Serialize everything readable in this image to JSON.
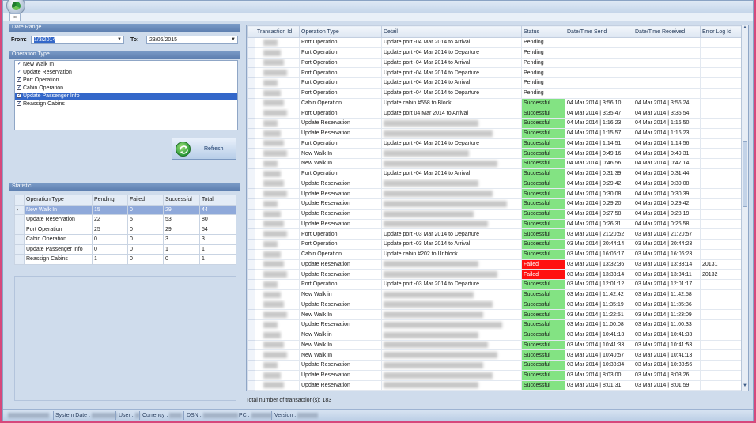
{
  "window": {
    "close_tab": "×"
  },
  "date_range": {
    "header": "Date Range",
    "from_label": "From:",
    "from_value": "1/3/2014",
    "to_label": "To:",
    "to_value": "23/06/2015"
  },
  "operation_type": {
    "header": "Operation Type",
    "items": [
      {
        "label": "New Walk In",
        "checked": true
      },
      {
        "label": "Update Reservation",
        "checked": true
      },
      {
        "label": "Port Operation",
        "checked": true
      },
      {
        "label": "Cabin Operation",
        "checked": true
      },
      {
        "label": "Update Passenger Info",
        "checked": true
      },
      {
        "label": "Reassign Cabins",
        "checked": true
      }
    ]
  },
  "refresh": {
    "label": "Refresh"
  },
  "statistic": {
    "header": "Statistic",
    "columns": [
      "Operation Type",
      "Pending",
      "Failed",
      "Successful",
      "Total"
    ],
    "rows": [
      [
        "New Walk In",
        "15",
        "0",
        "29",
        "44"
      ],
      [
        "Update Reservation",
        "22",
        "5",
        "53",
        "80"
      ],
      [
        "Port Operation",
        "25",
        "0",
        "29",
        "54"
      ],
      [
        "Cabin Operation",
        "0",
        "0",
        "3",
        "3"
      ],
      [
        "Update Passenger Info",
        "0",
        "0",
        "1",
        "1"
      ],
      [
        "Reassign Cabins",
        "1",
        "0",
        "0",
        "1"
      ]
    ]
  },
  "grid": {
    "columns": [
      "Transaction Id",
      "Operation Type",
      "Detail",
      "Status",
      "Date/Time Send",
      "Date/Time Received",
      "Error Log Id"
    ],
    "rows": [
      [
        "",
        "Port Operation",
        "Update port -04 Mar 2014 to Arrival",
        "Pending",
        "",
        "",
        ""
      ],
      [
        "",
        "Port Operation",
        "Update port -04 Mar 2014 to Departure",
        "Pending",
        "",
        "",
        ""
      ],
      [
        "",
        "Port Operation",
        "Update port -04 Mar 2014 to Arrival",
        "Pending",
        "",
        "",
        ""
      ],
      [
        "",
        "Port Operation",
        "Update port -04 Mar 2014 to Departure",
        "Pending",
        "",
        "",
        ""
      ],
      [
        "",
        "Port Operation",
        "Update port -04 Mar 2014 to Arrival",
        "Pending",
        "",
        "",
        ""
      ],
      [
        "",
        "Port Operation",
        "Update port -04 Mar 2014 to Departure",
        "Pending",
        "",
        "",
        ""
      ],
      [
        "",
        "Cabin Operation",
        "Update cabin #558 to Block",
        "Successful",
        "04 Mar 2014 | 3:56:10",
        "04 Mar 2014 | 3:56:24",
        ""
      ],
      [
        "",
        "Port Operation",
        "Update port 04 Mar 2014 to Arrival",
        "Successful",
        "04 Mar 2014 | 3:35:47",
        "04 Mar 2014 | 3:35:54",
        ""
      ],
      [
        "",
        "Update Reservation",
        "",
        "Successful",
        "04 Mar 2014 | 1:16:23",
        "04 Mar 2014 | 1:16:50",
        ""
      ],
      [
        "",
        "Update Reservation",
        "",
        "Successful",
        "04 Mar 2014 | 1:15:57",
        "04 Mar 2014 | 1:16:23",
        ""
      ],
      [
        "",
        "Port Operation",
        "Update port -04 Mar 2014 to Departure",
        "Successful",
        "04 Mar 2014 | 1:14:51",
        "04 Mar 2014 | 1:14:56",
        ""
      ],
      [
        "",
        "New Walk In",
        "",
        "Successful",
        "04 Mar 2014 | 0:49:16",
        "04 Mar 2014 | 0:49:31",
        ""
      ],
      [
        "",
        "New Walk In",
        "",
        "Successful",
        "04 Mar 2014 | 0:46:56",
        "04 Mar 2014 | 0:47:14",
        ""
      ],
      [
        "",
        "Port Operation",
        "Update port -04 Mar 2014 to Arrival",
        "Successful",
        "04 Mar 2014 | 0:31:39",
        "04 Mar 2014 | 0:31:44",
        ""
      ],
      [
        "",
        "Update Reservation",
        "",
        "Successful",
        "04 Mar 2014 | 0:29:42",
        "04 Mar 2014 | 0:30:08",
        ""
      ],
      [
        "",
        "Update Reservation",
        "",
        "Successful",
        "04 Mar 2014 | 0:30:08",
        "04 Mar 2014 | 0:30:39",
        ""
      ],
      [
        "",
        "Update Reservation",
        "",
        "Successful",
        "04 Mar 2014 | 0:29:20",
        "04 Mar 2014 | 0:29:42",
        ""
      ],
      [
        "",
        "Update Reservation",
        "",
        "Successful",
        "04 Mar 2014 | 0:27:58",
        "04 Mar 2014 | 0:28:19",
        ""
      ],
      [
        "",
        "Update Reservation",
        "",
        "Successful",
        "04 Mar 2014 | 0:26:31",
        "04 Mar 2014 | 0:26:58",
        ""
      ],
      [
        "",
        "Port Operation",
        "Update port -03 Mar 2014 to Departure",
        "Successful",
        "03 Mar 2014 | 21:20:52",
        "03 Mar 2014 | 21:20:57",
        ""
      ],
      [
        "",
        "Port Operation",
        "Update port -03 Mar 2014 to Arrival",
        "Successful",
        "03 Mar 2014 | 20:44:14",
        "03 Mar 2014 | 20:44:23",
        ""
      ],
      [
        "",
        "Cabin Operation",
        "Update cabin #202 to Unblock",
        "Successful",
        "03 Mar 2014 | 16:06:17",
        "03 Mar 2014 | 16:06:23",
        ""
      ],
      [
        "",
        "Update Reservation",
        "",
        "Failed",
        "03 Mar 2014 | 13:32:36",
        "03 Mar 2014 | 13:33:14",
        "20131"
      ],
      [
        "",
        "Update Reservation",
        "",
        "Failed",
        "03 Mar 2014 | 13:33:14",
        "03 Mar 2014 | 13:34:11",
        "20132"
      ],
      [
        "",
        "Port Operation",
        "Update port -03 Mar 2014 to Departure",
        "Successful",
        "03 Mar 2014 | 12:01:12",
        "03 Mar 2014 | 12:01:17",
        ""
      ],
      [
        "",
        "New Walk in",
        "",
        "Successful",
        "03 Mar 2014 | 11:42:42",
        "03 Mar 2014 | 11:42:58",
        ""
      ],
      [
        "",
        "Update Reservation",
        "",
        "Successful",
        "03 Mar 2014 | 11:35:19",
        "03 Mar 2014 | 11:35:36",
        ""
      ],
      [
        "",
        "New Walk In",
        "",
        "Successful",
        "03 Mar 2014 | 11:22:51",
        "03 Mar 2014 | 11:23:09",
        ""
      ],
      [
        "",
        "Update Reservation",
        "",
        "Successful",
        "03 Mar 2014 | 11:00:08",
        "03 Mar 2014 | 11:00:33",
        ""
      ],
      [
        "",
        "New Walk in",
        "",
        "Successful",
        "03 Mar 2014 | 10:41:13",
        "03 Mar 2014 | 10:41:33",
        ""
      ],
      [
        "",
        "New Walk In",
        "",
        "Successful",
        "03 Mar 2014 | 10:41:33",
        "03 Mar 2014 | 10:41:53",
        ""
      ],
      [
        "",
        "New Walk In",
        "",
        "Successful",
        "03 Mar 2014 | 10:40:57",
        "03 Mar 2014 | 10:41:13",
        ""
      ],
      [
        "",
        "Update Reservation",
        "",
        "Successful",
        "03 Mar 2014 | 10:38:34",
        "03 Mar 2014 | 10:38:56",
        ""
      ],
      [
        "",
        "Update Reservation",
        "",
        "Successful",
        "03 Mar 2014 | 8:03:00",
        "03 Mar 2014 | 8:03:26",
        ""
      ],
      [
        "",
        "Update Reservation",
        "",
        "Successful",
        "03 Mar 2014 | 8:01:31",
        "03 Mar 2014 | 8:01:59",
        ""
      ]
    ],
    "total_label": "Total number of transaction(s): 183"
  },
  "statusbar": {
    "system_date": "System Date :",
    "user": "User :",
    "currency": "Currency :",
    "dsn": "DSN :",
    "pc": "PC :",
    "version": "Version :"
  },
  "colors": {
    "successful": "#83e383",
    "failed": "#ff1010",
    "selection": "#3367c9"
  },
  "icons": [
    "app-orb-icon",
    "refresh-icon",
    "close-icon",
    "chevron-down-icon",
    "checkbox-checked-icon",
    "row-pointer-icon"
  ]
}
